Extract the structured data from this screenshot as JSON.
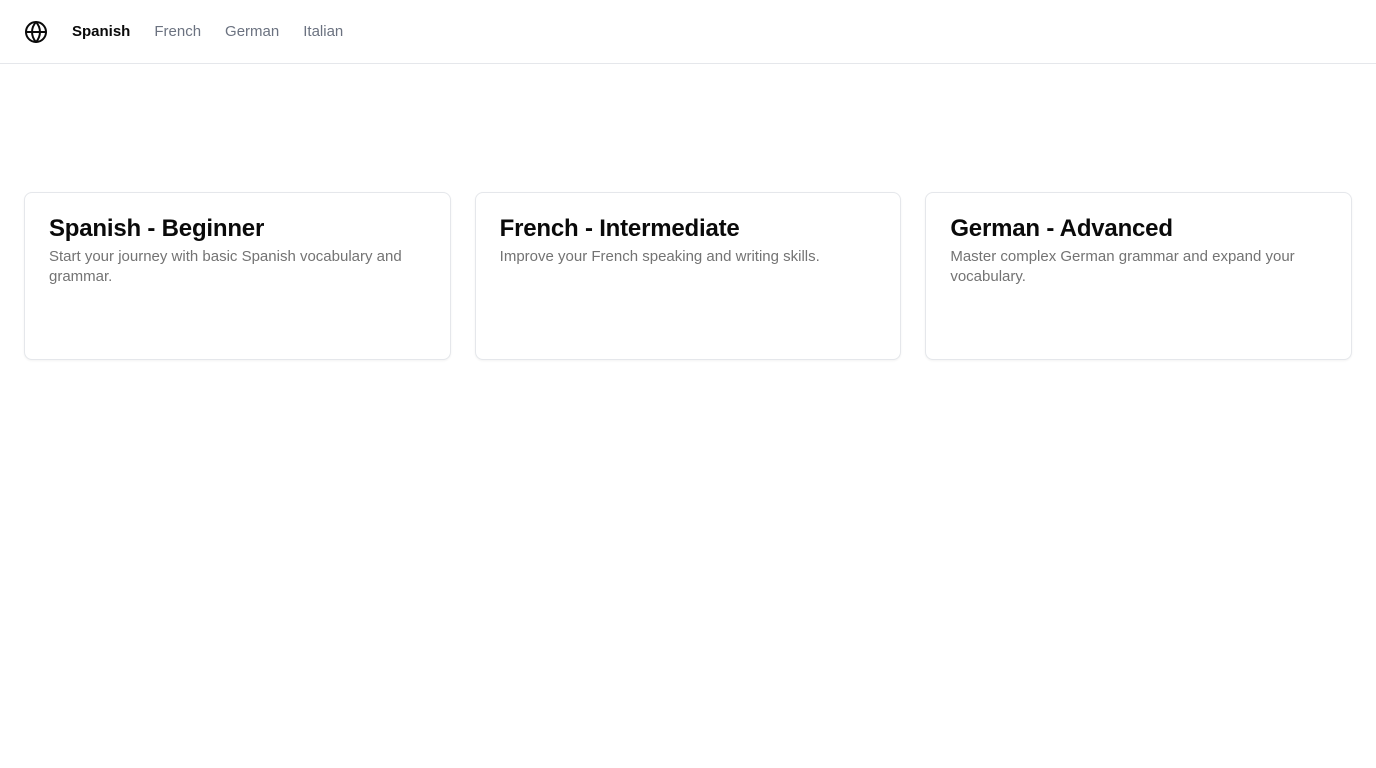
{
  "header": {
    "logo_icon": "globe-icon",
    "nav": [
      {
        "label": "Spanish",
        "active": true
      },
      {
        "label": "French",
        "active": false
      },
      {
        "label": "German",
        "active": false
      },
      {
        "label": "Italian",
        "active": false
      }
    ]
  },
  "courses": [
    {
      "title": "Spanish - Beginner",
      "description": "Start your journey with basic Spanish vocabulary and grammar."
    },
    {
      "title": "French - Intermediate",
      "description": "Improve your French speaking and writing skills."
    },
    {
      "title": "German - Advanced",
      "description": "Master complex German grammar and expand your vocabulary."
    }
  ],
  "colors": {
    "text_primary": "#0a0a0a",
    "text_muted": "#737373",
    "border": "#e5e7eb"
  }
}
